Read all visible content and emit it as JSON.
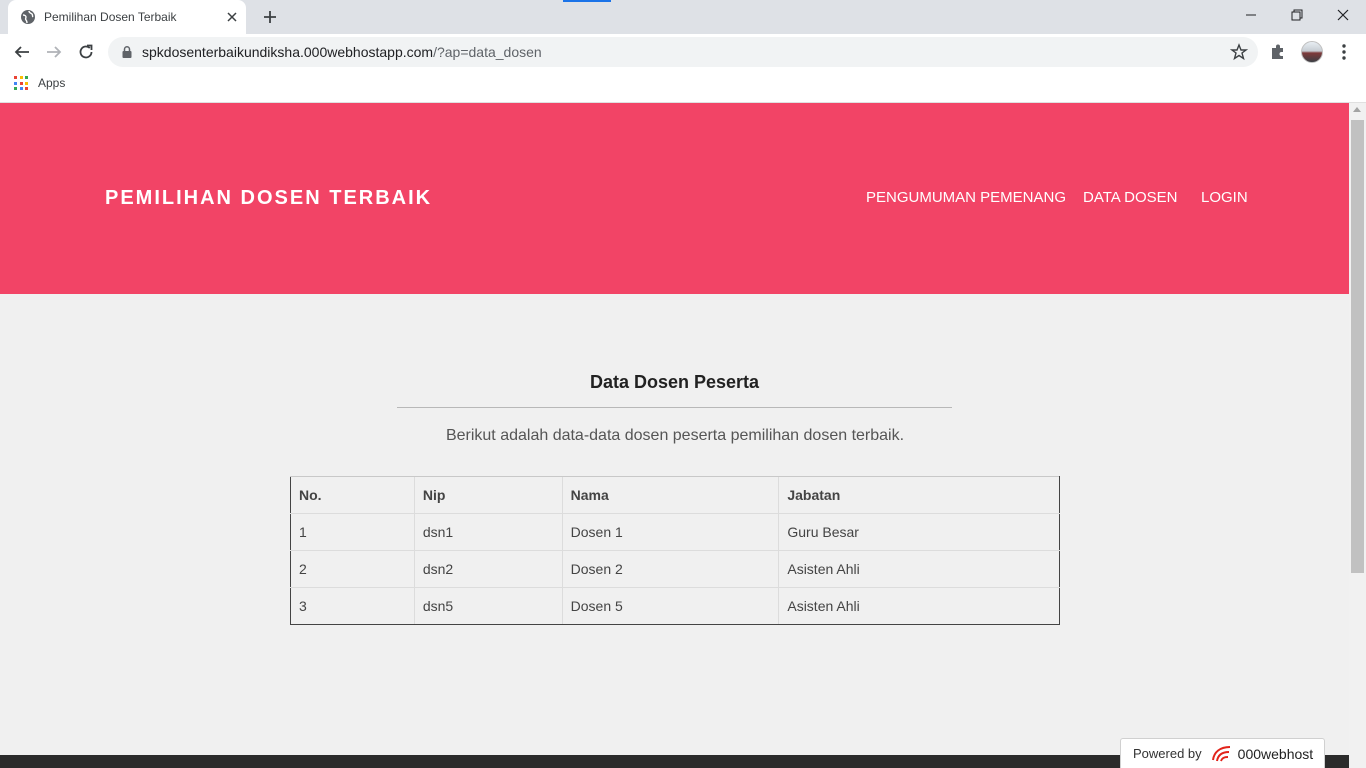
{
  "browser": {
    "tab_title": "Pemilihan Dosen Terbaik",
    "url_host": "spkdosenterbaikundiksha.000webhostapp.com",
    "url_path": "/?ap=data_dosen",
    "bookmark_apps": "Apps"
  },
  "site": {
    "brand": "PEMILIHAN DOSEN TERBAIK",
    "nav": [
      "PENGUMUMAN PEMENANG",
      "DATA DOSEN",
      "LOGIN"
    ],
    "header_color": "#f24466"
  },
  "main": {
    "heading": "Data Dosen Peserta",
    "lead": "Berikut adalah data-data dosen peserta pemilihan dosen terbaik.",
    "table": {
      "headers": [
        "No.",
        "Nip",
        "Nama",
        "Jabatan"
      ],
      "rows": [
        [
          "1",
          "dsn1",
          "Dosen 1",
          "Guru Besar"
        ],
        [
          "2",
          "dsn2",
          "Dosen 2",
          "Asisten Ahli"
        ],
        [
          "3",
          "dsn5",
          "Dosen 5",
          "Asisten Ahli"
        ]
      ]
    }
  },
  "footer": {
    "powered_label": "Powered by",
    "powered_brand": "000webhost"
  }
}
